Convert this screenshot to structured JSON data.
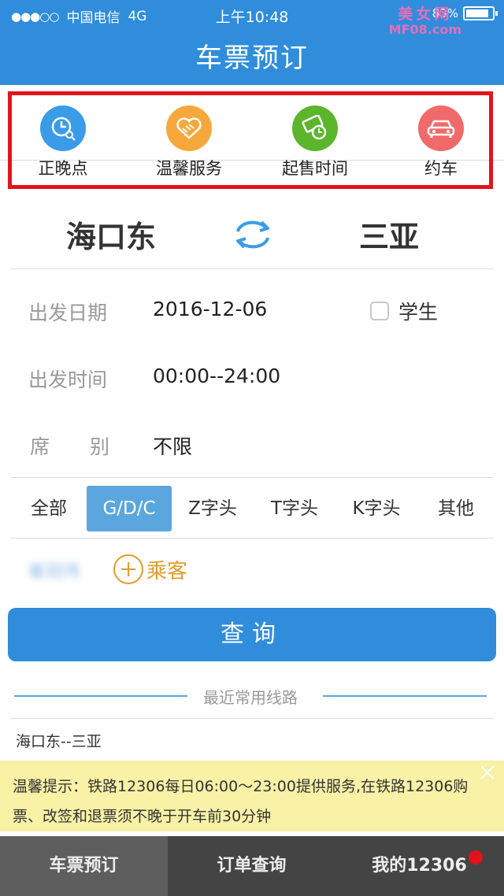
{
  "status_bar": {
    "signal": "●●●○○",
    "carrier": "中国电信",
    "network": "4G",
    "time": "上午10:48",
    "battery": "83%"
  },
  "watermark": {
    "line1": "美女网",
    "line2": "MF08.com"
  },
  "nav": {
    "title": "车票预订"
  },
  "quick_actions": [
    {
      "label": "正晚点",
      "icon": "clock-search-icon",
      "color": "#3a9ce8"
    },
    {
      "label": "温馨服务",
      "icon": "handshake-icon",
      "color": "#f7a83c"
    },
    {
      "label": "起售时间",
      "icon": "ticket-clock-icon",
      "color": "#5bb52d"
    },
    {
      "label": "约车",
      "icon": "car-icon",
      "color": "#f06a6a"
    }
  ],
  "route": {
    "from": "海口东",
    "to": "三亚"
  },
  "form": {
    "date_label": "出发日期",
    "date_value": "2016-12-06",
    "student_label": "学生",
    "time_label": "出发时间",
    "time_value": "00:00--24:00",
    "seat_label_1": "席",
    "seat_label_2": "别",
    "seat_value": "不限"
  },
  "train_types": [
    "全部",
    "G/D/C",
    "Z字头",
    "T字头",
    "K字头",
    "其他"
  ],
  "passenger": {
    "name_blurred": "崔冠伟",
    "add_label": "乘客"
  },
  "search_label": "查询",
  "recent": {
    "heading": "最近常用线路",
    "items": [
      "海口东--三亚"
    ]
  },
  "notice": "温馨提示：铁路12306每日06:00～23:00提供服务,在铁路12306购票、改签和退票须不晚于开车前30分钟",
  "tabs": [
    "车票预订",
    "订单查询",
    "我的12306"
  ],
  "colors": {
    "primary": "#2f8ddc",
    "accent_orange": "#e59a2c",
    "highlight_red": "#e3141c",
    "badge_red": "#e0121b"
  }
}
